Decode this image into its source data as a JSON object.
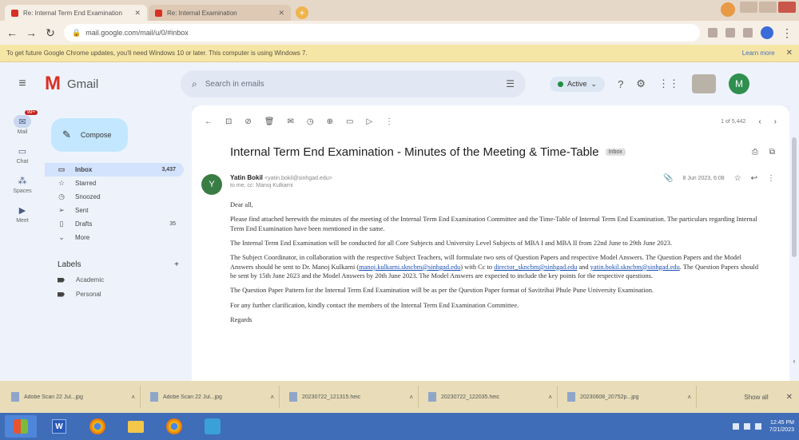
{
  "browser": {
    "tabs": [
      {
        "title": "Re: Internal Term End Examination"
      },
      {
        "title": "Re: Internal Examination"
      }
    ],
    "url": "mail.google.com/mail/u/0/#inbox",
    "infobar_text": "To get future Google Chrome updates, you'll need Windows 10 or later. This computer is using Windows 7.",
    "infobar_link": "Learn more"
  },
  "gmail": {
    "logo_text": "Gmail",
    "search_placeholder": "Search in emails",
    "status": "Active",
    "user_initial": "M"
  },
  "rail": [
    {
      "label": "Mail",
      "badge": "99+"
    },
    {
      "label": "Chat",
      "badge": ""
    },
    {
      "label": "Spaces",
      "badge": ""
    },
    {
      "label": "Meet",
      "badge": ""
    }
  ],
  "sidebar": {
    "compose": "Compose",
    "nav": [
      {
        "icon": "inbox-icon",
        "glyph": "▭",
        "label": "Inbox",
        "count": "3,437"
      },
      {
        "icon": "star-icon",
        "glyph": "☆",
        "label": "Starred",
        "count": ""
      },
      {
        "icon": "clock-icon",
        "glyph": "◷",
        "label": "Snoozed",
        "count": ""
      },
      {
        "icon": "send-icon",
        "glyph": "➢",
        "label": "Sent",
        "count": ""
      },
      {
        "icon": "draft-icon",
        "glyph": "▯",
        "label": "Drafts",
        "count": "35"
      },
      {
        "icon": "chevron-down-icon",
        "glyph": "⌄",
        "label": "More",
        "count": ""
      }
    ],
    "labels_title": "Labels",
    "labels": [
      "Academic",
      "Personal"
    ]
  },
  "message": {
    "pager": "1 of 5,442",
    "subject": "Internal Term End Examination - Minutes of the Meeting & Time-Table",
    "inbox_tag": "Inbox",
    "sender_name": "Yatin Bokil",
    "sender_email": "<yatin.bokil@sinhgad.edu>",
    "to_line": "to me, cc: Manoj Kulkarni",
    "date": "8 Jun 2023, 6:08",
    "body": {
      "greeting": "Dear all,",
      "p1": "Please find attached herewith the minutes of the meeting of the Internal Term End Examination Committee and the Time-Table of Internal Term End Examination. The particulars regarding Internal Term End Examination have been mentioned in the same.",
      "p2": "The Internal Term End Examination will be conducted for all Core Subjects and University Level Subjects of MBA I and MBA II from 22nd June to 29th June 2023.",
      "p3a": "The Subject Coordinator, in collaboration with the respective Subject Teachers, will formulate two sets of Question Papers and respective Model Answers. The Question Papers and the Model Answers should be sent to Dr. Manoj Kulkarni (",
      "p3_link1": "manoj.kulkarni.skncbm@sinhgad.edu",
      "p3b": ") with Cc to ",
      "p3_link2": "director_skncbm@sinhgad.edu",
      "p3c": " and ",
      "p3_link3": "yatin.bokil.skncbm@sinhgad.edu",
      "p3d": ". The Question Papers should be sent by 15th June 2023 and the Model Answers by 20th June 2023. The Model Answers are expected to include the key points for the respective questions.",
      "p4": "The Question Paper Pattern for the Internal Term End Examination will be as per the Question Paper format of Savitribai Phule Pune University Examination.",
      "p5": "For any further clarification, kindly contact the members of the Internal Term End Examination Committee.",
      "closing": "Regards"
    }
  },
  "downloads": {
    "items": [
      "Adobe Scan 22 Jul...jpg",
      "Adobe Scan 22 Jul...jpg",
      "20230722_121315.heic",
      "20230722_122035.heic",
      "20230608_20752p...jpg"
    ],
    "show_all": "Show all"
  },
  "taskbar": {
    "time": "12:45 PM",
    "date": "7/21/2023"
  }
}
